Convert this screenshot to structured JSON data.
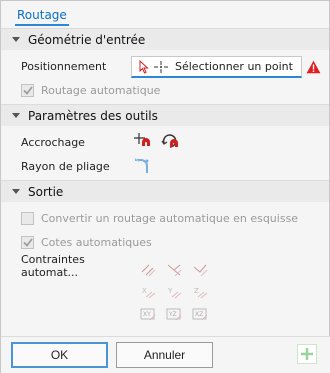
{
  "tab": {
    "label": "Routage"
  },
  "sections": {
    "input_geometry": {
      "title": "Géométrie d'entrée",
      "positioning_label": "Positionnement",
      "select_placeholder": "Sélectionner un point",
      "auto_routing_label": "Routage automatique",
      "auto_routing_checked": true
    },
    "tool_params": {
      "title": "Paramètres des outils",
      "snap_label": "Accrochage",
      "bend_radius_label": "Rayon de pliage"
    },
    "output": {
      "title": "Sortie",
      "convert_label": "Convertir un routage automatique en esquisse",
      "convert_checked": false,
      "auto_dims_label": "Cotes automatiques",
      "auto_dims_checked": true,
      "constraints_label": "Contraintes automat...",
      "constraint_icons": [
        "parallel-icon",
        "perpendicular-icon",
        "coincident-icon",
        "x-constraint-icon",
        "y-constraint-icon",
        "z-constraint-icon",
        "xy-plane-icon",
        "yz-plane-icon",
        "xz-plane-icon"
      ]
    }
  },
  "footer": {
    "ok_label": "OK",
    "cancel_label": "Annuler"
  },
  "colors": {
    "accent": "#2b88d8",
    "link": "#0a6fc7",
    "warning": "#e02020",
    "snap_red": "#d02020"
  }
}
